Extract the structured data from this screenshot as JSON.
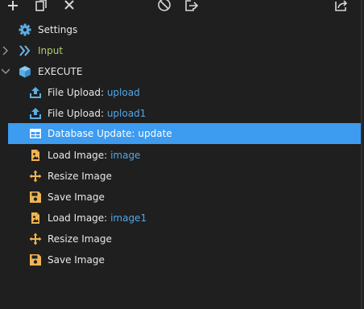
{
  "colors": {
    "background": "#1f1f1f",
    "selection": "#3d9bf0",
    "value_text": "#4fa8e8",
    "input_label": "#b5cc6e",
    "icon_orange": "#f0b552",
    "icon_blue": "#5aaee6"
  },
  "toolbar": {
    "add_icon": "plus-icon",
    "copy_icon": "copy-icon",
    "delete_icon": "close-icon",
    "disable_icon": "ban-icon",
    "export_icon": "export-icon",
    "share_icon": "share-icon"
  },
  "tree": {
    "settings": {
      "label": "Settings",
      "icon": "gear-icon"
    },
    "input": {
      "label": "Input",
      "icon": "chevron-double-right-icon",
      "expanded": false
    },
    "execute": {
      "label": "EXECUTE",
      "icon": "cube-icon",
      "expanded": true
    },
    "steps": [
      {
        "name": "File Upload:",
        "value": "upload",
        "icon": "upload-icon"
      },
      {
        "name": "File Upload:",
        "value": "upload1",
        "icon": "upload-icon"
      },
      {
        "name": "Database Update:",
        "value": "update",
        "icon": "table-icon",
        "selected": true
      },
      {
        "name": "Load Image:",
        "value": "image",
        "icon": "image-file-icon"
      },
      {
        "name": "Resize Image",
        "value": "",
        "icon": "move-arrows-icon"
      },
      {
        "name": "Save Image",
        "value": "",
        "icon": "floppy-disk-icon"
      },
      {
        "name": "Load Image:",
        "value": "image1",
        "icon": "image-file-icon"
      },
      {
        "name": "Resize Image",
        "value": "",
        "icon": "move-arrows-icon"
      },
      {
        "name": "Save Image",
        "value": "",
        "icon": "floppy-disk-icon"
      }
    ]
  }
}
